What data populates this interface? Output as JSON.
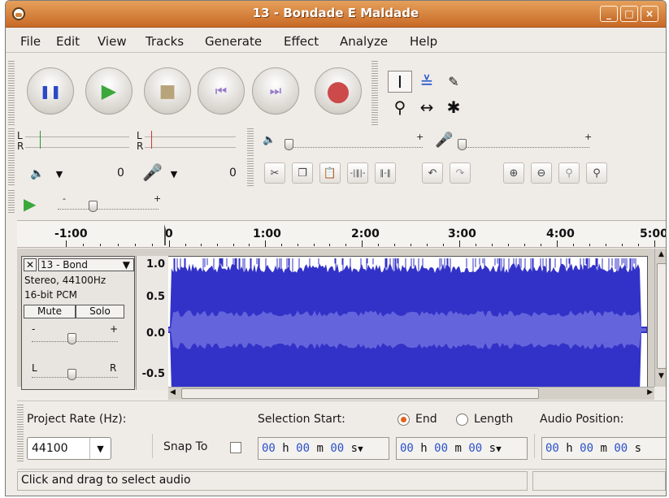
{
  "window": {
    "title": "13 - Bondade E Maldade",
    "controls": {
      "minimize": "_",
      "maximize": "□",
      "close": "×"
    }
  },
  "menu": {
    "items": [
      "File",
      "Edit",
      "View",
      "Tracks",
      "Generate",
      "Effect",
      "Analyze",
      "Help"
    ]
  },
  "transport": {
    "buttons": [
      {
        "name": "pause-button",
        "icon": "pause-icon",
        "glyph": "❚❚",
        "color": "#2a48c8"
      },
      {
        "name": "play-button",
        "icon": "play-icon",
        "glyph": "▶",
        "color": "#3aa83a"
      },
      {
        "name": "stop-button",
        "icon": "stop-icon",
        "glyph": "■",
        "color": "#b8a47a"
      },
      {
        "name": "skip-start-button",
        "icon": "skip-start-icon",
        "glyph": "⏮",
        "color": "#9a7acc"
      },
      {
        "name": "skip-end-button",
        "icon": "skip-end-icon",
        "glyph": "⏭",
        "color": "#9a7acc"
      },
      {
        "name": "record-button",
        "icon": "record-icon",
        "glyph": "●",
        "color": "#cc4a4a"
      }
    ]
  },
  "tools": {
    "selection": "I",
    "envelope": "≚",
    "draw": "✎",
    "zoom": "⚲",
    "timeshift": "↔",
    "multi": "✱"
  },
  "meters": {
    "left_label": "L",
    "right_label": "R",
    "play_volume_value": "0",
    "record_volume_value": "0"
  },
  "mixer": {
    "plus": "+"
  },
  "transcription": {
    "plus": "+"
  },
  "ruler": {
    "labels": [
      "-1:00",
      "0",
      "1:00",
      "2:00",
      "3:00",
      "4:00",
      "5:00"
    ]
  },
  "track": {
    "name": "13 - Bond",
    "info1": "Stereo, 44100Hz",
    "info2": "16-bit PCM",
    "mute": "Mute",
    "solo": "Solo",
    "gain_minus": "-",
    "gain_plus": "+",
    "pan_left": "L",
    "pan_right": "R",
    "close": "✕",
    "scale": [
      "1.0",
      "0.5",
      "0.0",
      "-0.5"
    ],
    "wave_color": "#3232c8",
    "wave_color_light": "#6464dc"
  },
  "selection": {
    "project_rate_label": "Project Rate (Hz):",
    "project_rate_value": "44100",
    "snap_to_label": "Snap To",
    "selection_start_label": "Selection Start:",
    "end_label": "End",
    "length_label": "Length",
    "audio_position_label": "Audio Position:",
    "time_h": "h",
    "time_m": "m",
    "time_s": "s",
    "digits": "00"
  },
  "status": {
    "message": "Click and drag to select audio"
  }
}
